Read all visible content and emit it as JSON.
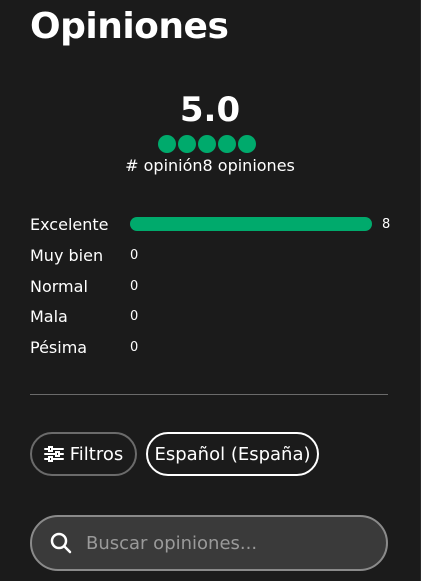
{
  "reviews": {
    "title": "Opiniones",
    "rating_value": "5.0",
    "rating_bubbles": 5,
    "count_text": "# opinión8 opiniones",
    "distribution": [
      {
        "label": "Excelente",
        "count": "8",
        "fraction": 1.0
      },
      {
        "label": "Muy bien",
        "count": "0",
        "fraction": 0
      },
      {
        "label": "Normal",
        "count": "0",
        "fraction": 0
      },
      {
        "label": "Mala",
        "count": "0",
        "fraction": 0
      },
      {
        "label": "Pésima",
        "count": "0",
        "fraction": 0
      }
    ],
    "filters_label": "Filtros",
    "filters_icon": "sliders-icon",
    "language_label": "Español (España)",
    "search": {
      "placeholder": "Buscar opiniones...",
      "value": "",
      "icon": "search-icon"
    }
  },
  "colors": {
    "background": "#1b1b1b",
    "accent_green": "#00aa6c",
    "text": "#ffffff",
    "muted_border": "#6b6b6b"
  }
}
